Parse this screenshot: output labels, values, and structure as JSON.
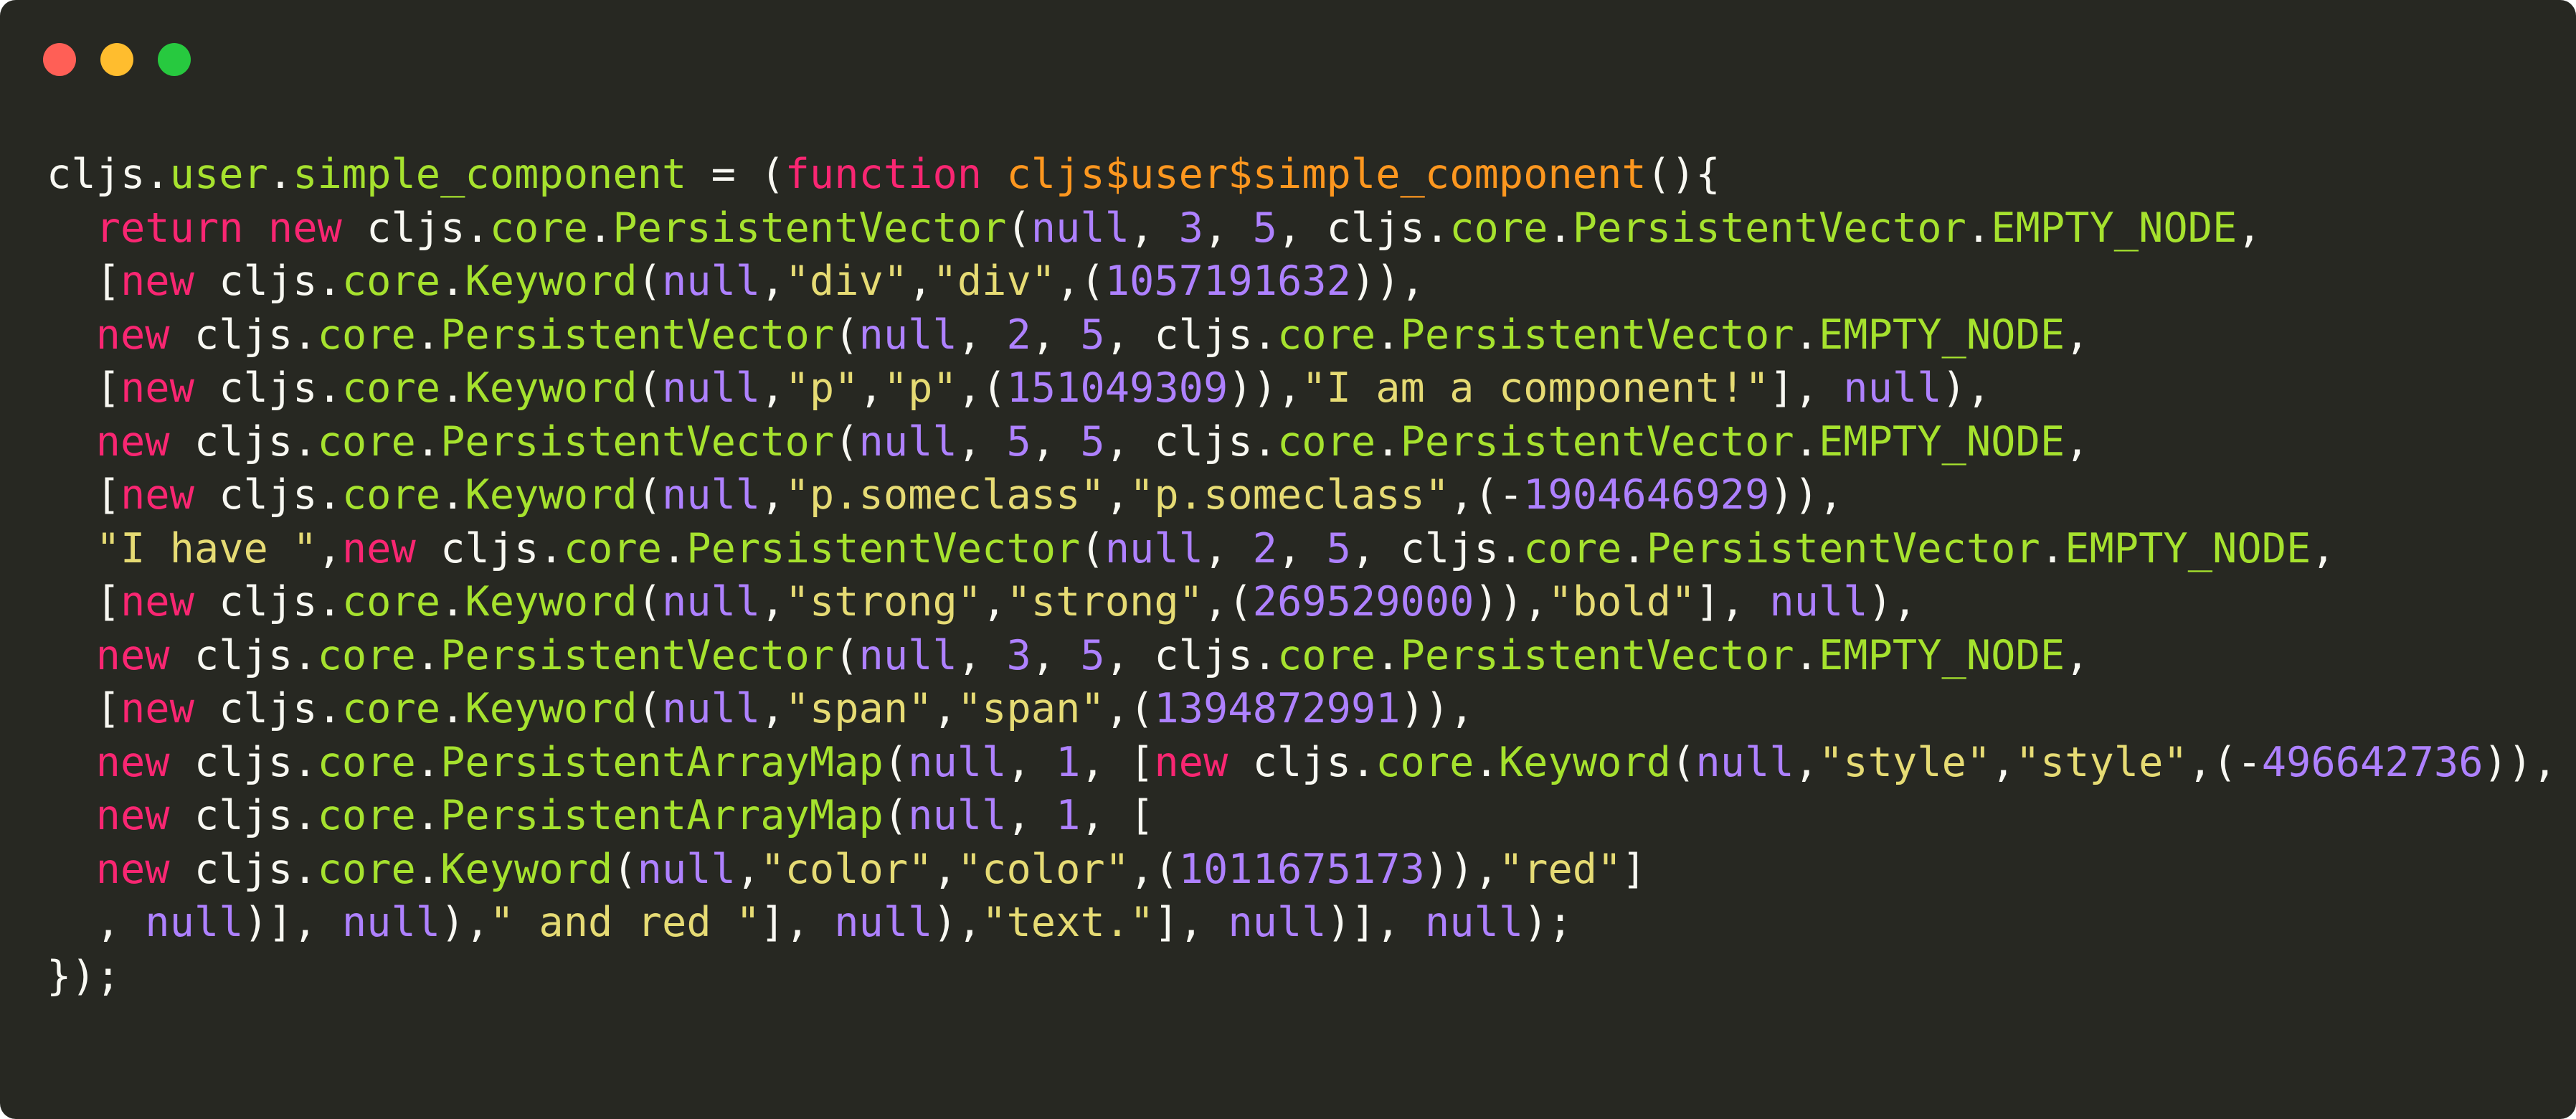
{
  "window": {
    "controls": [
      {
        "name": "close-button",
        "color": "#ff5f56"
      },
      {
        "name": "minimize-button",
        "color": "#ffbd2e"
      },
      {
        "name": "zoom-button",
        "color": "#27c93f"
      }
    ],
    "background": "#272822"
  },
  "theme": {
    "plain": "#f8f8f2",
    "keyword": "#f92672",
    "function_name": "#fd971f",
    "property": "#a6e22e",
    "number": "#ae81ff",
    "string": "#e6db74"
  },
  "code_lines": [
    [
      [
        "plain",
        "cljs."
      ],
      [
        "prop",
        "user"
      ],
      [
        "plain",
        "."
      ],
      [
        "prop",
        "simple_component"
      ],
      [
        "plain",
        " = ("
      ],
      [
        "kw",
        "function"
      ],
      [
        "plain",
        " "
      ],
      [
        "fn",
        "cljs$user$simple_component"
      ],
      [
        "plain",
        "(){"
      ]
    ],
    [
      [
        "plain",
        "  "
      ],
      [
        "kw",
        "return"
      ],
      [
        "plain",
        " "
      ],
      [
        "kw",
        "new"
      ],
      [
        "plain",
        " cljs."
      ],
      [
        "prop",
        "core"
      ],
      [
        "plain",
        "."
      ],
      [
        "prop",
        "PersistentVector"
      ],
      [
        "plain",
        "("
      ],
      [
        "num",
        "null"
      ],
      [
        "plain",
        ", "
      ],
      [
        "num",
        "3"
      ],
      [
        "plain",
        ", "
      ],
      [
        "num",
        "5"
      ],
      [
        "plain",
        ", cljs."
      ],
      [
        "prop",
        "core"
      ],
      [
        "plain",
        "."
      ],
      [
        "prop",
        "PersistentVector"
      ],
      [
        "plain",
        "."
      ],
      [
        "prop",
        "EMPTY_NODE"
      ],
      [
        "plain",
        ","
      ]
    ],
    [
      [
        "plain",
        "  ["
      ],
      [
        "kw",
        "new"
      ],
      [
        "plain",
        " cljs."
      ],
      [
        "prop",
        "core"
      ],
      [
        "plain",
        "."
      ],
      [
        "prop",
        "Keyword"
      ],
      [
        "plain",
        "("
      ],
      [
        "num",
        "null"
      ],
      [
        "plain",
        ","
      ],
      [
        "str",
        "\"div\""
      ],
      [
        "plain",
        ","
      ],
      [
        "str",
        "\"div\""
      ],
      [
        "plain",
        ",("
      ],
      [
        "num",
        "1057191632"
      ],
      [
        "plain",
        "))"
      ],
      [
        "plain",
        ","
      ]
    ],
    [
      [
        "plain",
        "  "
      ],
      [
        "kw",
        "new"
      ],
      [
        "plain",
        " cljs."
      ],
      [
        "prop",
        "core"
      ],
      [
        "plain",
        "."
      ],
      [
        "prop",
        "PersistentVector"
      ],
      [
        "plain",
        "("
      ],
      [
        "num",
        "null"
      ],
      [
        "plain",
        ", "
      ],
      [
        "num",
        "2"
      ],
      [
        "plain",
        ", "
      ],
      [
        "num",
        "5"
      ],
      [
        "plain",
        ", cljs."
      ],
      [
        "prop",
        "core"
      ],
      [
        "plain",
        "."
      ],
      [
        "prop",
        "PersistentVector"
      ],
      [
        "plain",
        "."
      ],
      [
        "prop",
        "EMPTY_NODE"
      ],
      [
        "plain",
        ","
      ]
    ],
    [
      [
        "plain",
        "  ["
      ],
      [
        "kw",
        "new"
      ],
      [
        "plain",
        " cljs."
      ],
      [
        "prop",
        "core"
      ],
      [
        "plain",
        "."
      ],
      [
        "prop",
        "Keyword"
      ],
      [
        "plain",
        "("
      ],
      [
        "num",
        "null"
      ],
      [
        "plain",
        ","
      ],
      [
        "str",
        "\"p\""
      ],
      [
        "plain",
        ","
      ],
      [
        "str",
        "\"p\""
      ],
      [
        "plain",
        ",("
      ],
      [
        "num",
        "151049309"
      ],
      [
        "plain",
        "))"
      ],
      [
        "plain",
        ","
      ],
      [
        "str",
        "\"I am a component!\""
      ],
      [
        "plain",
        "], "
      ],
      [
        "num",
        "null"
      ],
      [
        "plain",
        "),"
      ]
    ],
    [
      [
        "plain",
        "  "
      ],
      [
        "kw",
        "new"
      ],
      [
        "plain",
        " cljs."
      ],
      [
        "prop",
        "core"
      ],
      [
        "plain",
        "."
      ],
      [
        "prop",
        "PersistentVector"
      ],
      [
        "plain",
        "("
      ],
      [
        "num",
        "null"
      ],
      [
        "plain",
        ", "
      ],
      [
        "num",
        "5"
      ],
      [
        "plain",
        ", "
      ],
      [
        "num",
        "5"
      ],
      [
        "plain",
        ", cljs."
      ],
      [
        "prop",
        "core"
      ],
      [
        "plain",
        "."
      ],
      [
        "prop",
        "PersistentVector"
      ],
      [
        "plain",
        "."
      ],
      [
        "prop",
        "EMPTY_NODE"
      ],
      [
        "plain",
        ","
      ]
    ],
    [
      [
        "plain",
        "  ["
      ],
      [
        "kw",
        "new"
      ],
      [
        "plain",
        " cljs."
      ],
      [
        "prop",
        "core"
      ],
      [
        "plain",
        "."
      ],
      [
        "prop",
        "Keyword"
      ],
      [
        "plain",
        "("
      ],
      [
        "num",
        "null"
      ],
      [
        "plain",
        ","
      ],
      [
        "str",
        "\"p.someclass\""
      ],
      [
        "plain",
        ","
      ],
      [
        "str",
        "\"p.someclass\""
      ],
      [
        "plain",
        ",(-"
      ],
      [
        "num",
        "1904646929"
      ],
      [
        "plain",
        "))"
      ],
      [
        "plain",
        ","
      ]
    ],
    [
      [
        "plain",
        "  "
      ],
      [
        "str",
        "\"I have \""
      ],
      [
        "plain",
        ","
      ],
      [
        "kw",
        "new"
      ],
      [
        "plain",
        " cljs."
      ],
      [
        "prop",
        "core"
      ],
      [
        "plain",
        "."
      ],
      [
        "prop",
        "PersistentVector"
      ],
      [
        "plain",
        "("
      ],
      [
        "num",
        "null"
      ],
      [
        "plain",
        ", "
      ],
      [
        "num",
        "2"
      ],
      [
        "plain",
        ", "
      ],
      [
        "num",
        "5"
      ],
      [
        "plain",
        ", cljs."
      ],
      [
        "prop",
        "core"
      ],
      [
        "plain",
        "."
      ],
      [
        "prop",
        "PersistentVector"
      ],
      [
        "plain",
        "."
      ],
      [
        "prop",
        "EMPTY_NODE"
      ],
      [
        "plain",
        ","
      ]
    ],
    [
      [
        "plain",
        "  ["
      ],
      [
        "kw",
        "new"
      ],
      [
        "plain",
        " cljs."
      ],
      [
        "prop",
        "core"
      ],
      [
        "plain",
        "."
      ],
      [
        "prop",
        "Keyword"
      ],
      [
        "plain",
        "("
      ],
      [
        "num",
        "null"
      ],
      [
        "plain",
        ","
      ],
      [
        "str",
        "\"strong\""
      ],
      [
        "plain",
        ","
      ],
      [
        "str",
        "\"strong\""
      ],
      [
        "plain",
        ",("
      ],
      [
        "num",
        "269529000"
      ],
      [
        "plain",
        "))"
      ],
      [
        "plain",
        ","
      ],
      [
        "str",
        "\"bold\""
      ],
      [
        "plain",
        "], "
      ],
      [
        "num",
        "null"
      ],
      [
        "plain",
        "),"
      ]
    ],
    [
      [
        "plain",
        "  "
      ],
      [
        "kw",
        "new"
      ],
      [
        "plain",
        " cljs."
      ],
      [
        "prop",
        "core"
      ],
      [
        "plain",
        "."
      ],
      [
        "prop",
        "PersistentVector"
      ],
      [
        "plain",
        "("
      ],
      [
        "num",
        "null"
      ],
      [
        "plain",
        ", "
      ],
      [
        "num",
        "3"
      ],
      [
        "plain",
        ", "
      ],
      [
        "num",
        "5"
      ],
      [
        "plain",
        ", cljs."
      ],
      [
        "prop",
        "core"
      ],
      [
        "plain",
        "."
      ],
      [
        "prop",
        "PersistentVector"
      ],
      [
        "plain",
        "."
      ],
      [
        "prop",
        "EMPTY_NODE"
      ],
      [
        "plain",
        ","
      ]
    ],
    [
      [
        "plain",
        "  ["
      ],
      [
        "kw",
        "new"
      ],
      [
        "plain",
        " cljs."
      ],
      [
        "prop",
        "core"
      ],
      [
        "plain",
        "."
      ],
      [
        "prop",
        "Keyword"
      ],
      [
        "plain",
        "("
      ],
      [
        "num",
        "null"
      ],
      [
        "plain",
        ","
      ],
      [
        "str",
        "\"span\""
      ],
      [
        "plain",
        ","
      ],
      [
        "str",
        "\"span\""
      ],
      [
        "plain",
        ",("
      ],
      [
        "num",
        "1394872991"
      ],
      [
        "plain",
        "))"
      ],
      [
        "plain",
        ","
      ]
    ],
    [
      [
        "plain",
        "  "
      ],
      [
        "kw",
        "new"
      ],
      [
        "plain",
        " cljs."
      ],
      [
        "prop",
        "core"
      ],
      [
        "plain",
        "."
      ],
      [
        "prop",
        "PersistentArrayMap"
      ],
      [
        "plain",
        "("
      ],
      [
        "num",
        "null"
      ],
      [
        "plain",
        ", "
      ],
      [
        "num",
        "1"
      ],
      [
        "plain",
        ", ["
      ],
      [
        "kw",
        "new"
      ],
      [
        "plain",
        " cljs."
      ],
      [
        "prop",
        "core"
      ],
      [
        "plain",
        "."
      ],
      [
        "prop",
        "Keyword"
      ],
      [
        "plain",
        "("
      ],
      [
        "num",
        "null"
      ],
      [
        "plain",
        ","
      ],
      [
        "str",
        "\"style\""
      ],
      [
        "plain",
        ","
      ],
      [
        "str",
        "\"style\""
      ],
      [
        "plain",
        ",(-"
      ],
      [
        "num",
        "496642736"
      ],
      [
        "plain",
        "))"
      ],
      [
        "plain",
        ","
      ]
    ],
    [
      [
        "plain",
        "  "
      ],
      [
        "kw",
        "new"
      ],
      [
        "plain",
        " cljs."
      ],
      [
        "prop",
        "core"
      ],
      [
        "plain",
        "."
      ],
      [
        "prop",
        "PersistentArrayMap"
      ],
      [
        "plain",
        "("
      ],
      [
        "num",
        "null"
      ],
      [
        "plain",
        ", "
      ],
      [
        "num",
        "1"
      ],
      [
        "plain",
        ", ["
      ]
    ],
    [
      [
        "plain",
        "  "
      ],
      [
        "kw",
        "new"
      ],
      [
        "plain",
        " cljs."
      ],
      [
        "prop",
        "core"
      ],
      [
        "plain",
        "."
      ],
      [
        "prop",
        "Keyword"
      ],
      [
        "plain",
        "("
      ],
      [
        "num",
        "null"
      ],
      [
        "plain",
        ","
      ],
      [
        "str",
        "\"color\""
      ],
      [
        "plain",
        ","
      ],
      [
        "str",
        "\"color\""
      ],
      [
        "plain",
        ",("
      ],
      [
        "num",
        "1011675173"
      ],
      [
        "plain",
        "))"
      ],
      [
        "plain",
        ","
      ],
      [
        "str",
        "\"red\""
      ],
      [
        "plain",
        "]"
      ]
    ],
    [
      [
        "plain",
        "  , "
      ],
      [
        "num",
        "null"
      ],
      [
        "plain",
        ")], "
      ],
      [
        "num",
        "null"
      ],
      [
        "plain",
        ")"
      ],
      [
        "plain",
        ","
      ],
      [
        "str",
        "\" and red \""
      ],
      [
        "plain",
        "], "
      ],
      [
        "num",
        "null"
      ],
      [
        "plain",
        ")"
      ],
      [
        "plain",
        ","
      ],
      [
        "str",
        "\"text.\""
      ],
      [
        "plain",
        "], "
      ],
      [
        "num",
        "null"
      ],
      [
        "plain",
        ")], "
      ],
      [
        "num",
        "null"
      ],
      [
        "plain",
        ");"
      ]
    ],
    [
      [
        "plain",
        "});"
      ]
    ]
  ]
}
